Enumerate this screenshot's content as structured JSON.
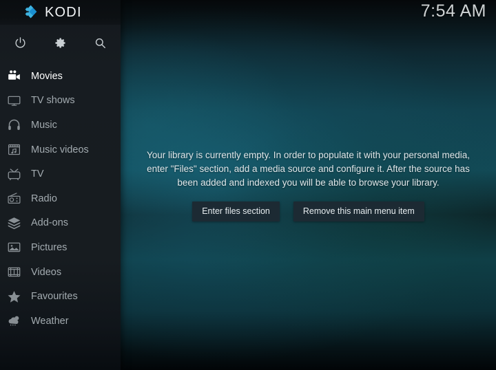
{
  "app": {
    "name": "KODI",
    "logo_icon": "kodi-logo-icon",
    "logo_color_light": "#3eb3e0",
    "logo_color_dark": "#1a8fd0"
  },
  "header": {
    "clock": "7:54 AM"
  },
  "sidebar": {
    "actions": [
      {
        "name": "power-icon",
        "label": "Power"
      },
      {
        "name": "gear-icon",
        "label": "Settings"
      },
      {
        "name": "search-icon",
        "label": "Search"
      }
    ],
    "items": [
      {
        "label": "Movies",
        "icon": "movie-camera-icon",
        "selected": true
      },
      {
        "label": "TV shows",
        "icon": "tv-monitor-icon",
        "selected": false
      },
      {
        "label": "Music",
        "icon": "headphones-icon",
        "selected": false
      },
      {
        "label": "Music videos",
        "icon": "music-video-icon",
        "selected": false
      },
      {
        "label": "TV",
        "icon": "retro-tv-icon",
        "selected": false
      },
      {
        "label": "Radio",
        "icon": "radio-icon",
        "selected": false
      },
      {
        "label": "Add-ons",
        "icon": "addon-box-icon",
        "selected": false
      },
      {
        "label": "Pictures",
        "icon": "picture-icon",
        "selected": false
      },
      {
        "label": "Videos",
        "icon": "filmstrip-icon",
        "selected": false
      },
      {
        "label": "Favourites",
        "icon": "star-icon",
        "selected": false
      },
      {
        "label": "Weather",
        "icon": "weather-cloud-icon",
        "selected": false
      }
    ]
  },
  "main": {
    "empty_message": "Your library is currently empty. In order to populate it with your personal media, enter \"Files\" section, add a media source and configure it. After the source has been added and indexed you will be able to browse your library.",
    "buttons": [
      {
        "label": "Enter files section"
      },
      {
        "label": "Remove this main menu item"
      }
    ]
  }
}
